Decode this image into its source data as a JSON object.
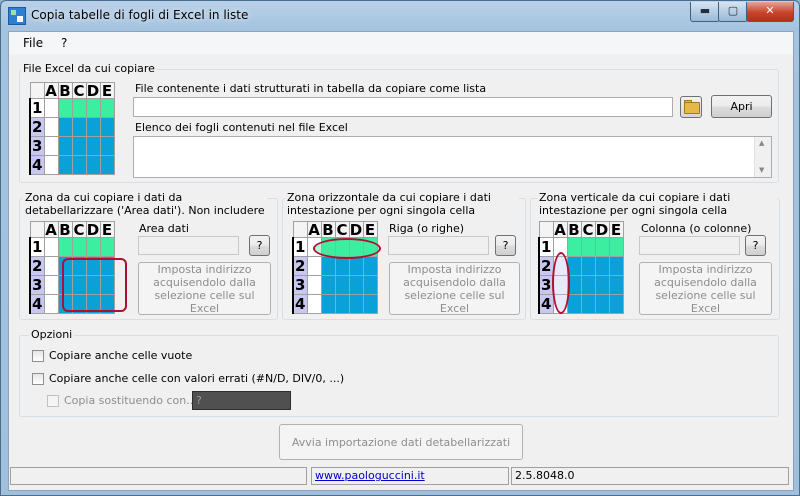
{
  "window": {
    "title": "Copia tabelle di fogli di Excel in liste"
  },
  "menu": {
    "file": "File",
    "help": "?"
  },
  "file_group": {
    "title": "File Excel da cui copiare",
    "file_label": "File contenente i dati strutturati in tabella da copiare come lista",
    "file_value": "",
    "open_button": "Apri",
    "sheets_label": "Elenco dei fogli contenuti nel file Excel"
  },
  "sheet_grid": {
    "columns": [
      "A",
      "B",
      "C",
      "D",
      "E"
    ],
    "rows": [
      "1",
      "2",
      "3",
      "4"
    ]
  },
  "data_area": {
    "title": "Zona da cui copiare i dati da detabellarizzare ('Area dati'). Non includere le righe e colonne di",
    "field_label": "Area dati",
    "help_button": "?",
    "set_button": "Imposta indirizzo acquisendolo dalla selezione celle sul Excel"
  },
  "horiz_area": {
    "title": "Zona orizzontale da cui copiare i dati intestazione per ogni singola cella dell'area dati",
    "field_label": "Riga (o righe)",
    "help_button": "?",
    "set_button": "Imposta indirizzo acquisendolo dalla selezione celle sul Excel"
  },
  "vert_area": {
    "title": "Zona verticale da cui copiare i dati intestazione per ogni singola cella dell'area dati",
    "field_label": "Colonna (o colonne)",
    "help_button": "?",
    "set_button": "Imposta indirizzo acquisendolo dalla selezione celle sul Excel"
  },
  "options": {
    "title": "Opzioni",
    "copy_empty": "Copiare anche celle vuote",
    "copy_errors": "Copiare anche celle con valori errati (#N/D, DIV/0, ...)",
    "copy_replace": "Copia sostituendo con...",
    "replace_value": "?"
  },
  "start_button": "Avvia importazione dati detabellarizzati",
  "status": {
    "left": "",
    "link": "www.paologuccini.it",
    "version": "2.5.8048.0"
  },
  "colors": {
    "header_green": "#3ceea0",
    "data_blue": "#0aa0d8",
    "row_header": "#c7c7f0",
    "highlight_red": "#b01030"
  }
}
